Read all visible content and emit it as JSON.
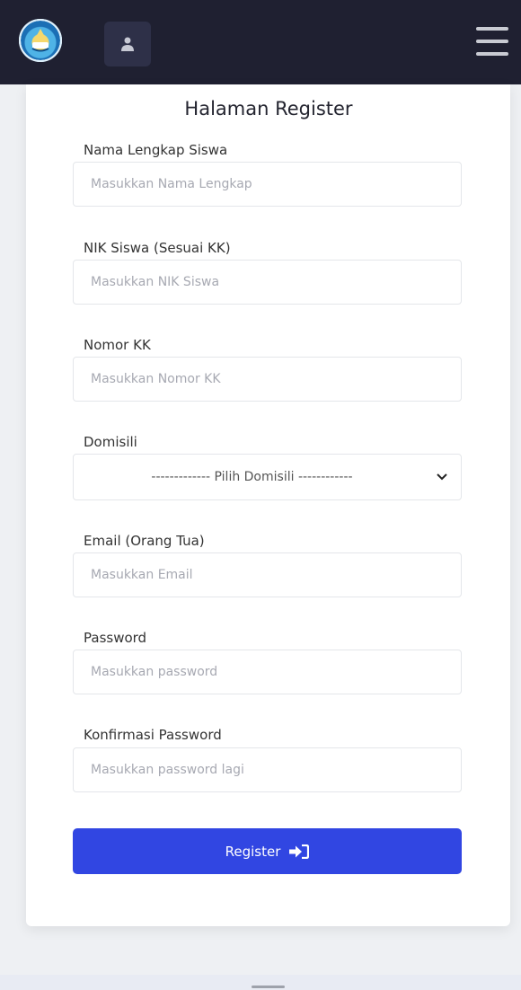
{
  "header": {
    "logo_icon": "tut-wuri-handayani-logo-icon",
    "user_icon": "user-icon",
    "menu_icon": "hamburger-menu-icon"
  },
  "form": {
    "title": "Halaman Register",
    "fields": [
      {
        "label": "Nama Lengkap Siswa",
        "placeholder": "Masukkan Nama Lengkap",
        "value": ""
      },
      {
        "label": "NIK Siswa (Sesuai KK)",
        "placeholder": "Masukkan NIK Siswa",
        "value": ""
      },
      {
        "label": "Nomor KK",
        "placeholder": "Masukkan Nomor KK",
        "value": ""
      },
      {
        "label": "Domisili",
        "selected": "------------- Pilih Domisili ------------"
      },
      {
        "label": "Email (Orang Tua)",
        "placeholder": "Masukkan Email",
        "value": ""
      },
      {
        "label": "Password",
        "placeholder": "Masukkan password",
        "value": ""
      },
      {
        "label": "Konfirmasi Password",
        "placeholder": "Masukkan password lagi",
        "value": ""
      }
    ],
    "submit_label": "Register",
    "submit_icon": "sign-in-icon"
  },
  "colors": {
    "navbar": "#1f2031",
    "primary_button": "#3146e2",
    "background": "#eef0f3"
  }
}
